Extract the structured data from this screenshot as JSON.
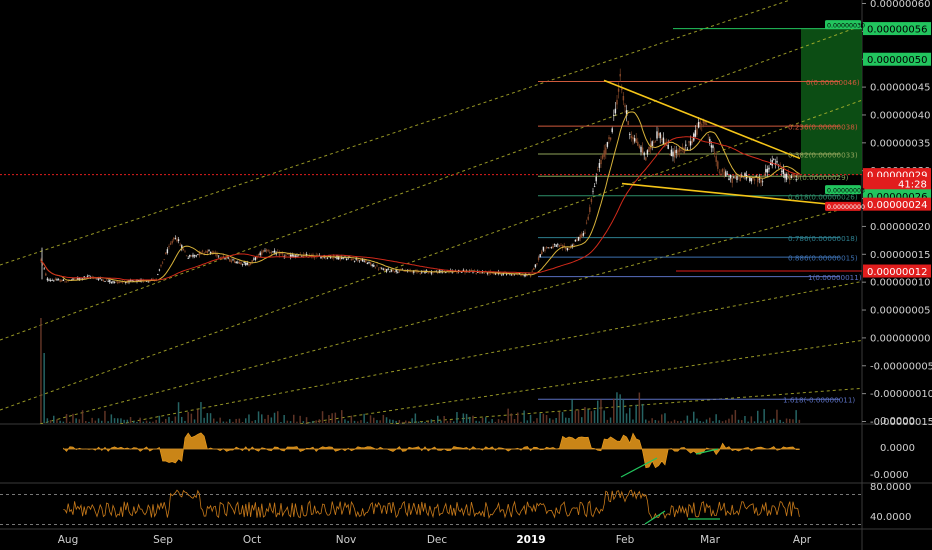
{
  "chart_data": [
    {
      "type": "candlestick",
      "pane": "price",
      "x_tick_labels": [
        "Aug",
        "Sep",
        "Oct",
        "Nov",
        "Dec",
        "2019",
        "Feb",
        "Mar",
        "Apr"
      ],
      "y_tick_labels": [
        "0.00000060",
        "0.00000055",
        "0.00000050",
        "0.00000045",
        "0.00000040",
        "0.00000035",
        "0.00000030",
        "0.00000025",
        "0.00000020",
        "0.00000015",
        "0.00000010",
        "0.00000005",
        "0.00000000",
        "-0.00000005",
        "-0.00000010",
        "-0.00000015"
      ],
      "ylim": [
        -1.5e-07,
        6e-07
      ],
      "price_path": [
        [
          "2018-07-28",
          1.4e-07
        ],
        [
          "2018-07-30",
          1.05e-07
        ],
        [
          "2018-08-05",
          1.02e-07
        ],
        [
          "2018-08-12",
          1.1e-07
        ],
        [
          "2018-08-20",
          1e-07
        ],
        [
          "2018-08-28",
          1.02e-07
        ],
        [
          "2018-09-02",
          1.05e-07
        ],
        [
          "2018-09-05",
          1.5e-07
        ],
        [
          "2018-09-08",
          1.82e-07
        ],
        [
          "2018-09-12",
          1.45e-07
        ],
        [
          "2018-09-18",
          1.56e-07
        ],
        [
          "2018-09-25",
          1.4e-07
        ],
        [
          "2018-10-01",
          1.32e-07
        ],
        [
          "2018-10-06",
          1.58e-07
        ],
        [
          "2018-10-12",
          1.48e-07
        ],
        [
          "2018-10-20",
          1.47e-07
        ],
        [
          "2018-10-28",
          1.45e-07
        ],
        [
          "2018-11-05",
          1.4e-07
        ],
        [
          "2018-11-12",
          1.22e-07
        ],
        [
          "2018-11-20",
          1.2e-07
        ],
        [
          "2018-11-28",
          1.18e-07
        ],
        [
          "2018-12-05",
          1.2e-07
        ],
        [
          "2018-12-15",
          1.17e-07
        ],
        [
          "2018-12-22",
          1.15e-07
        ],
        [
          "2018-12-28",
          1.12e-07
        ],
        [
          "2019-01-01",
          1.6e-07
        ],
        [
          "2019-01-05",
          1.65e-07
        ],
        [
          "2019-01-09",
          1.6e-07
        ],
        [
          "2019-01-14",
          1.9e-07
        ],
        [
          "2019-01-18",
          3e-07
        ],
        [
          "2019-01-22",
          3.6e-07
        ],
        [
          "2019-01-25",
          4.62e-07
        ],
        [
          "2019-01-28",
          3.7e-07
        ],
        [
          "2019-02-02",
          3.25e-07
        ],
        [
          "2019-02-06",
          3.7e-07
        ],
        [
          "2019-02-10",
          3.3e-07
        ],
        [
          "2019-02-15",
          3.4e-07
        ],
        [
          "2019-02-20",
          3.95e-07
        ],
        [
          "2019-02-25",
          3e-07
        ],
        [
          "2019-03-01",
          2.85e-07
        ],
        [
          "2019-03-05",
          2.9e-07
        ],
        [
          "2019-03-10",
          2.82e-07
        ],
        [
          "2019-03-14",
          3.2e-07
        ],
        [
          "2019-03-18",
          2.9e-07
        ],
        [
          "2019-03-22",
          2.9e-07
        ]
      ],
      "fibonacci_levels": [
        {
          "label": "0(0.00000046)",
          "value": 4.6e-07,
          "color": "#cf5a3c"
        },
        {
          "label": "0.236(0.00000038)",
          "value": 3.8e-07,
          "color": "#cf5a3c"
        },
        {
          "label": "0.382(0.00000033)",
          "value": 3.3e-07,
          "color": "#8fa35a"
        },
        {
          "label": "0.5(0.00000029)",
          "value": 2.9e-07,
          "color": "#7fa35a"
        },
        {
          "label": "0.618(0.00000026)",
          "value": 2.55e-07,
          "color": "#2e8f6a"
        },
        {
          "label": "0.786(0.00000018)",
          "value": 1.8e-07,
          "color": "#2d7f8f"
        },
        {
          "label": "0.886(0.00000015)",
          "value": 1.45e-07,
          "color": "#3c6fb0"
        },
        {
          "label": "1(0.00000011)",
          "value": 1.1e-07,
          "color": "#5a6fc0"
        },
        {
          "label": "1.618(-0.00000011)",
          "value": -1.1e-07,
          "color": "#5a6fc0"
        }
      ],
      "price_markers": [
        {
          "label": "0.00000056",
          "value": 5.55e-07,
          "bg": "#22c55e",
          "fg": "#000000"
        },
        {
          "label": "0.00000050",
          "value": 5e-07,
          "bg": "#22c55e",
          "fg": "#000000"
        },
        {
          "label": "0.00000029",
          "value": 2.93e-07,
          "bg": "#e11d1d",
          "fg": "#ffffff"
        },
        {
          "label": "41:28",
          "value": 2.77e-07,
          "bg": "#e11d1d",
          "fg": "#ffffff"
        },
        {
          "label": "0.00000026",
          "value": 2.55e-07,
          "bg": "#22c55e",
          "fg": "#000000"
        },
        {
          "label": "0.00000024",
          "value": 2.4e-07,
          "bg": "#e11d1d",
          "fg": "#ffffff"
        },
        {
          "label": "0.00000012",
          "value": 1.2e-07,
          "bg": "#e11d1d",
          "fg": "#ffffff"
        }
      ],
      "inline_tags": [
        {
          "label": "0.00000030",
          "value": 5.62e-07,
          "bg": "#22c55e",
          "fg": "#000000"
        },
        {
          "label": "0.00000003",
          "value": 2.66e-07,
          "bg": "#22c55e",
          "fg": "#000000"
        },
        {
          "label": "0.00000000",
          "value": 2.36e-07,
          "bg": "#e11d1d",
          "fg": "#ffffff"
        }
      ]
    },
    {
      "type": "area",
      "pane": "oscillator",
      "y_tick_labels": [
        "0.0000",
        "0.0000",
        "-0.0000"
      ]
    },
    {
      "type": "line",
      "pane": "rsi",
      "y_tick_labels": [
        "80.0000",
        "40.0000"
      ]
    }
  ]
}
